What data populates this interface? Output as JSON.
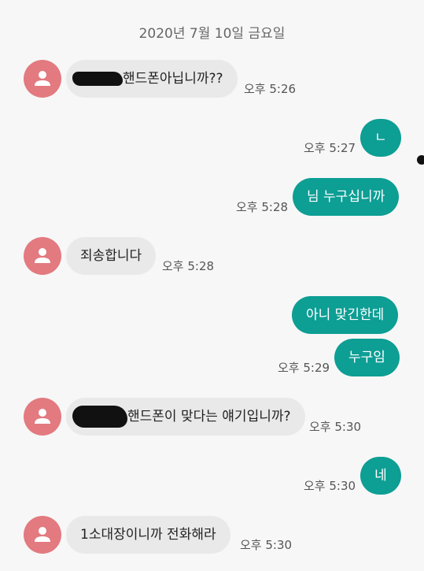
{
  "date_header": "2020년 7월 10일 금요일",
  "messages": [
    {
      "side": "in",
      "text": "핸드폰아닙니까??",
      "time": "오후 5:26"
    },
    {
      "side": "out",
      "text": "ㄴ",
      "time": "오후 5:27"
    },
    {
      "side": "out",
      "text": "님 누구십니까",
      "time": "오후 5:28"
    },
    {
      "side": "in",
      "text": "죄송합니다",
      "time": "오후 5:28"
    },
    {
      "side": "out",
      "text": "아니 맞긴한데",
      "time": ""
    },
    {
      "side": "out",
      "text": "누구임",
      "time": "오후 5:29"
    },
    {
      "side": "in",
      "text": "핸드폰이 맞다는 얘기입니까?",
      "time": "오후 5:30"
    },
    {
      "side": "out",
      "text": "네",
      "time": "오후 5:30"
    },
    {
      "side": "in",
      "text": "1소대장이니까 전화해라",
      "time": "오후 5:30"
    }
  ],
  "colors": {
    "outgoing": "#0d9e94",
    "incoming": "#e9e9e9",
    "avatar": "#e27a80"
  },
  "icons": {
    "avatar": "person-icon"
  }
}
